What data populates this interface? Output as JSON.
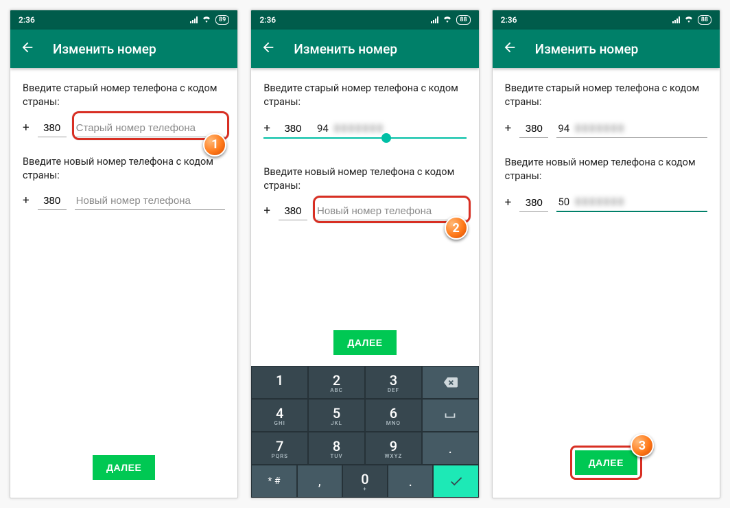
{
  "status": {
    "time": "2:36",
    "battery1": "89",
    "battery2": "88",
    "battery3": "88"
  },
  "appbar": {
    "title": "Изменить номер"
  },
  "prompts": {
    "old": "Введите старый номер телефона с кодом страны:",
    "new": "Введите новый номер телефона с кодом страны:"
  },
  "placeholders": {
    "old": "Старый номер телефона",
    "new": "Новый номер телефона"
  },
  "cc": "380",
  "plus": "+",
  "values": {
    "s2_old_prefix": "94",
    "s3_old_prefix": "94",
    "s3_new_prefix": "50"
  },
  "buttons": {
    "next": "ДАЛЕЕ"
  },
  "steps": {
    "1": "1",
    "2": "2",
    "3": "3"
  },
  "keypad": {
    "sub2": "ABC",
    "sub3": "DEF",
    "sub4": "GHI",
    "sub5": "JKL",
    "sub6": "MNO",
    "sub7": "PQRS",
    "sub8": "TUV",
    "sub9": "WXYZ",
    "sub0": "+",
    "k1": "1",
    "k2": "2",
    "k3": "3",
    "k4": "4",
    "k5": "5",
    "k6": "6",
    "k7": "7",
    "k8": "8",
    "k9": "9",
    "k0": "0",
    "comma": ",",
    "period": ".",
    "hash": "* #",
    "dot2": "."
  }
}
